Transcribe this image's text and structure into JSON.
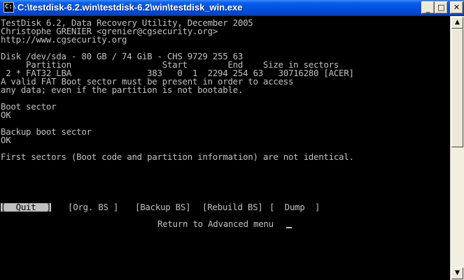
{
  "window": {
    "title": "C:\\testdisk-6.2.win\\testdisk-6.2\\win\\testdisk_win.exe",
    "icon_text": "C:\\",
    "controls": {
      "minimize": "_",
      "maximize": "□",
      "close": "✕"
    }
  },
  "console": {
    "header": [
      "TestDisk 6.2, Data Recovery Utility, December 2005",
      "Christophe GRENIER <grenier@cgsecurity.org>",
      "http://www.cgsecurity.org"
    ],
    "disk_line": "Disk /dev/sda - 80 GB / 74 GiB - CHS 9729 255 63",
    "partition_header": "     Partition                  Start        End    Size in sectors",
    "partition_row": " 2 * FAT32 LBA               383   0  1  2294 254 63   30716280 [ACER]",
    "warning": [
      "A valid FAT Boot sector must be present in order to access",
      "any data; even if the partition is not bootable."
    ],
    "boot_sector_label": "Boot sector",
    "boot_sector_status": "OK",
    "backup_boot_sector_label": "Backup boot sector",
    "backup_boot_sector_status": "OK",
    "comparison": "First sectors (Boot code and partition information) are not identical.",
    "menu": [
      {
        "label": "[  Quit  ]",
        "selected": true
      },
      {
        "label": "[Org. BS ]",
        "selected": false
      },
      {
        "label": "[Backup BS]",
        "selected": false
      },
      {
        "label": "[Rebuild BS]",
        "selected": false
      },
      {
        "label": "[  Dump  ]",
        "selected": false
      }
    ],
    "hint": "Return to Advanced menu"
  },
  "scrollbar": {
    "up_arrow": "▲",
    "down_arrow": "▼"
  },
  "colors": {
    "console_bg": "#000000",
    "console_fg": "#c0c0c0",
    "titlebar": "#0053e1"
  }
}
